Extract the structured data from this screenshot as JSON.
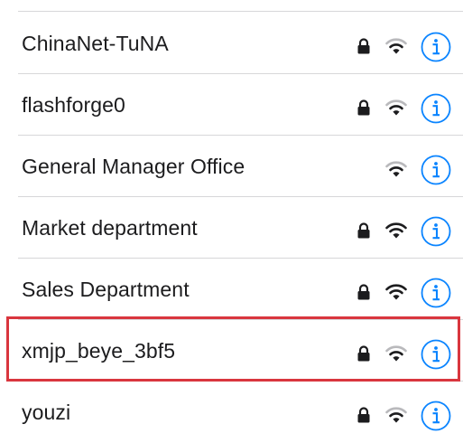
{
  "networks": [
    {
      "name": "ChinaNet-TuNA",
      "secured": true,
      "signal": "strong-faded"
    },
    {
      "name": "flashforge0",
      "secured": true,
      "signal": "strong-faded"
    },
    {
      "name": "General Manager Office",
      "secured": false,
      "signal": "strong-faded"
    },
    {
      "name": "Market department",
      "secured": true,
      "signal": "strong"
    },
    {
      "name": "Sales Department",
      "secured": true,
      "signal": "strong"
    },
    {
      "name": "xmjp_beye_3bf5",
      "secured": true,
      "signal": "strong-faded",
      "highlighted": true
    },
    {
      "name": "youzi",
      "secured": true,
      "signal": "strong-faded"
    }
  ],
  "icons": {
    "lock": "lock-icon",
    "wifi": "wifi-icon",
    "info": "info-icon"
  },
  "colors": {
    "accent": "#0a84ff",
    "highlight": "#d9363e",
    "separator": "#d7d7d9"
  }
}
